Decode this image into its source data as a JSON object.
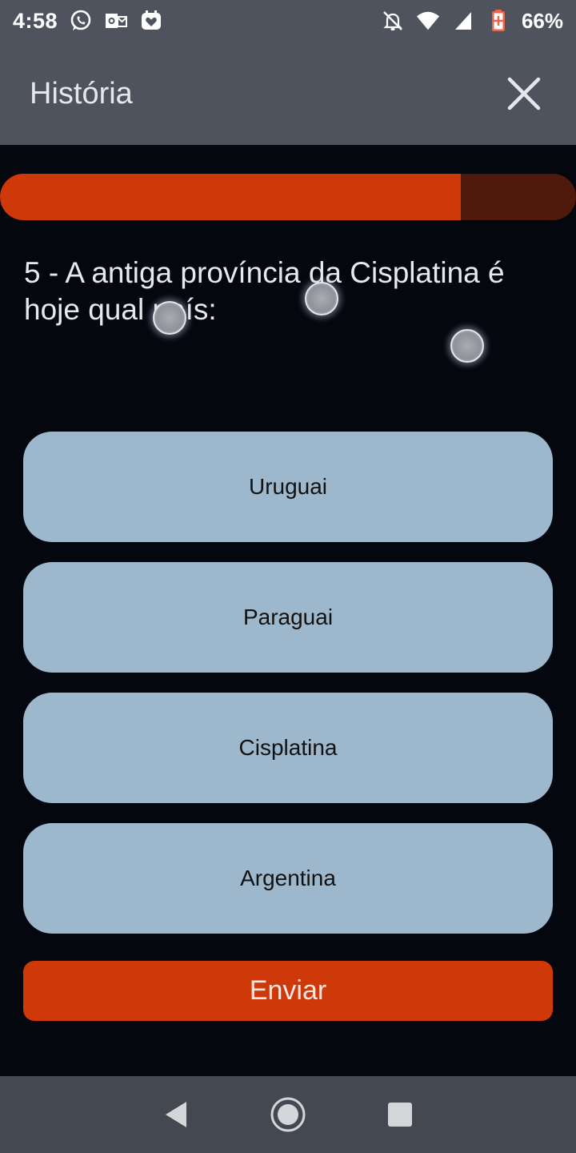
{
  "status_bar": {
    "time": "4:58",
    "battery_percent": "66%",
    "left_icons": [
      "whatsapp-icon",
      "outlook-icon",
      "heart-message-icon"
    ],
    "right_icons": [
      "notifications-off-icon",
      "wifi-icon",
      "signal-icon",
      "battery-icon"
    ]
  },
  "app_bar": {
    "title": "História",
    "close_icon": "close-icon"
  },
  "progress": {
    "value": 0.8,
    "fill_color": "#cf3909",
    "track_color": "#4f1a0c"
  },
  "question": {
    "text": "5 - A antiga província da Cisplatina é hoje qual país:"
  },
  "options": [
    {
      "label": "Uruguai"
    },
    {
      "label": "Paraguai"
    },
    {
      "label": "Cisplatina"
    },
    {
      "label": "Argentina"
    }
  ],
  "submit": {
    "label": "Enviar"
  },
  "colors": {
    "background": "#05070f",
    "bar": "#4f535d",
    "option_bg": "#9db8cc",
    "accent": "#cf3909"
  },
  "nav_bar": {
    "buttons": [
      "back-icon",
      "home-icon",
      "recents-icon"
    ]
  }
}
